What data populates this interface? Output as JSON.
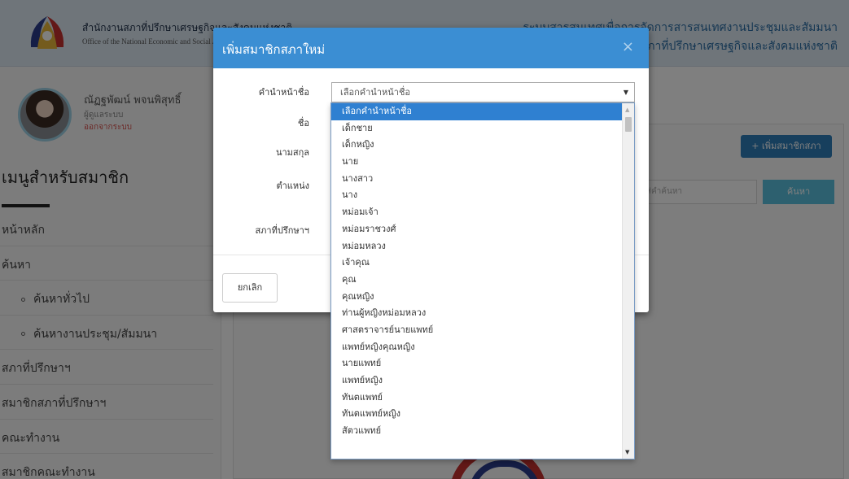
{
  "header": {
    "org_name_th": "สำนักงานสภาที่ปรึกษาเศรษฐกิจและสังคมแห่งชาติ",
    "org_name_en": "Office of the National Economic and Social Advisory Council",
    "system_title_line1": "ระบบสารสนเทศเพื่อการจัดการสารสนเทศงานประชุมและสัมมนา",
    "system_title_line2": "สำนักงานสภาที่ปรึกษาเศรษฐกิจและสังคมแห่งชาติ"
  },
  "user": {
    "name": "ณัฏฐพัฒน์ พจนพิสุทธิ์",
    "role": "ผู้ดูแลระบบ",
    "logout": "ออกจากระบบ"
  },
  "sidebar": {
    "title": "เมนูสำหรับสมาชิก",
    "items": [
      {
        "label": "หน้าหลัก"
      },
      {
        "label": "ค้นหา"
      },
      {
        "label": "ค้นหาทั่วไป"
      },
      {
        "label": "ค้นหางานประชุม/สัมมนา"
      },
      {
        "label": "สภาที่ปรึกษาฯ"
      },
      {
        "label": "สมาชิกสภาที่ปรึกษาฯ"
      },
      {
        "label": "คณะทำงาน"
      },
      {
        "label": "สมาชิกคณะทำงาน"
      }
    ]
  },
  "main": {
    "add_member_button": "+ เพิ่มสมาชิกสภา",
    "search_placeholder": "ใส่คำค้นหา",
    "search_button": "ค้นหา"
  },
  "modal": {
    "title": "เพิ่มสมาชิกสภาใหม่",
    "close": "×",
    "labels": {
      "prefix": "คำนำหน้าชื่อ",
      "first_name": "ชื่อ",
      "last_name": "นามสกุล",
      "position": "ตำแหน่ง",
      "council": "สภาที่ปรึกษาฯ"
    },
    "prefix_select_value": "เลือกคำนำหน้าชื่อ",
    "cancel_button": "ยกเลิก"
  },
  "dropdown": {
    "options": [
      {
        "label": "เลือกคำนำหน้าชื่อ"
      },
      {
        "label": "เด็กชาย"
      },
      {
        "label": "เด็กหญิง"
      },
      {
        "label": "นาย"
      },
      {
        "label": "นางสาว"
      },
      {
        "label": "นาง"
      },
      {
        "label": "หม่อมเจ้า"
      },
      {
        "label": "หม่อมราชวงศ์"
      },
      {
        "label": "หม่อมหลวง"
      },
      {
        "label": "เจ้าคุณ"
      },
      {
        "label": "คุณ"
      },
      {
        "label": "คุณหญิง"
      },
      {
        "label": "ท่านผู้หญิงหม่อมหลวง"
      },
      {
        "label": "ศาสตราจารย์นายแพทย์"
      },
      {
        "label": "แพทย์หญิงคุณหญิง"
      },
      {
        "label": "นายแพทย์"
      },
      {
        "label": "แพทย์หญิง"
      },
      {
        "label": "ทันตแพทย์"
      },
      {
        "label": "ทันตแพทย์หญิง"
      },
      {
        "label": "สัตวแพทย์"
      }
    ]
  },
  "colors": {
    "modal_header": "#3b8ed3",
    "selected_option": "#2f80d1",
    "primary_button": "#2f7fba",
    "search_button": "#5bc0de",
    "logout_text": "#d9534f"
  }
}
